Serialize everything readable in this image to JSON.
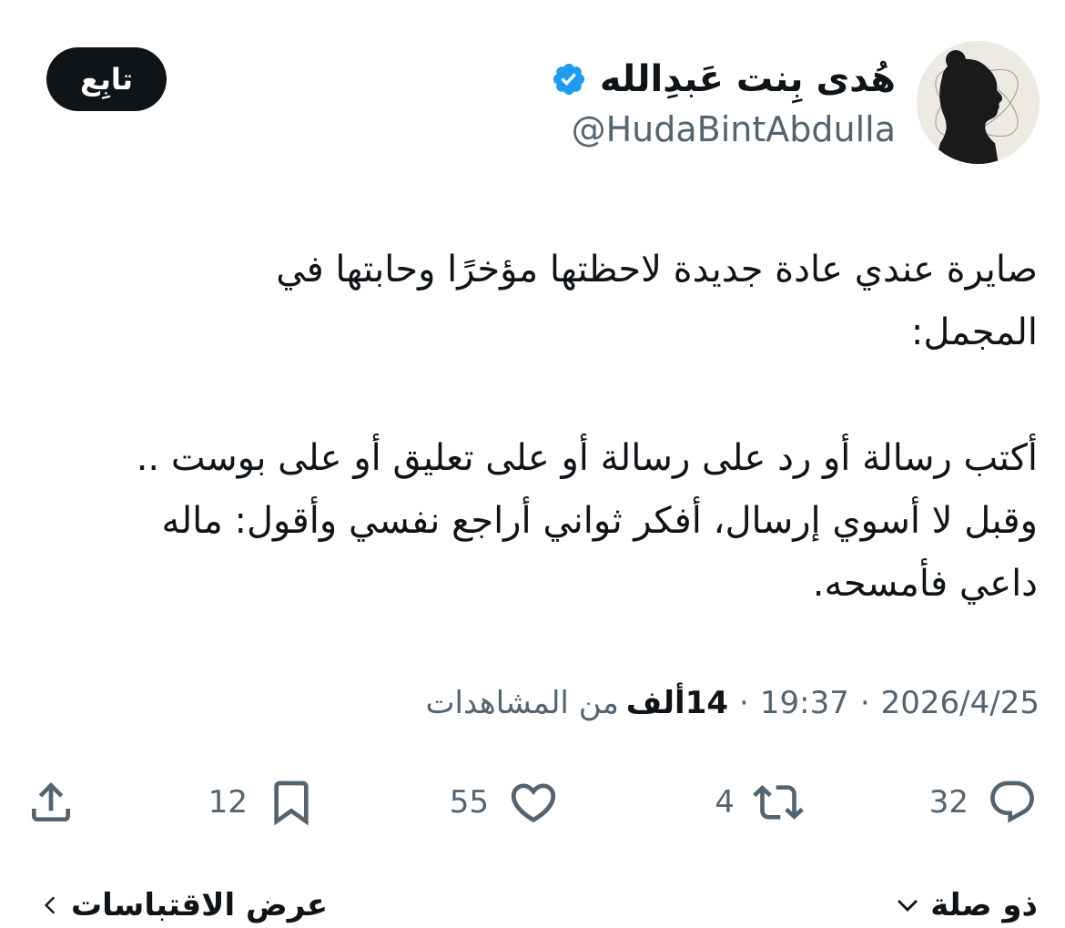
{
  "author": {
    "name": "هُدى بِنت عَبدِالله",
    "handle": "@HudaBintAbdulla",
    "verified_color": "#1d9bf0"
  },
  "follow_button": {
    "label": "تابِع"
  },
  "tweet": {
    "lines": [
      "صايرة عندي عادة جديدة لاحظتها مؤخرًا وحابتها في",
      "المجمل:",
      "أكتب رسالة أو رد على رسالة أو على تعليق أو على بوست ..",
      "وقبل لا أسوي إرسال، أفكر ثواني أراجع نفسي وأقول: ماله",
      "داعي فأمسحه."
    ]
  },
  "meta": {
    "date": "2026/4/25",
    "time": "19:37",
    "views_count": "14ألف",
    "views_label": "من المشاهدات",
    "separator": "·"
  },
  "actions": {
    "reply": {
      "icon": "reply-icon",
      "count": "32"
    },
    "retweet": {
      "icon": "retweet-icon",
      "count": "4"
    },
    "like": {
      "icon": "heart-icon",
      "count": "55"
    },
    "bookmark": {
      "icon": "bookmark-icon",
      "count": "12"
    },
    "share": {
      "icon": "share-icon"
    }
  },
  "footer": {
    "relevant_label": "ذو صلة",
    "quotes_label": "عرض الاقتباسات"
  },
  "colors": {
    "text": "#0f1419",
    "secondary": "#536471",
    "button_bg": "#0f1419"
  }
}
